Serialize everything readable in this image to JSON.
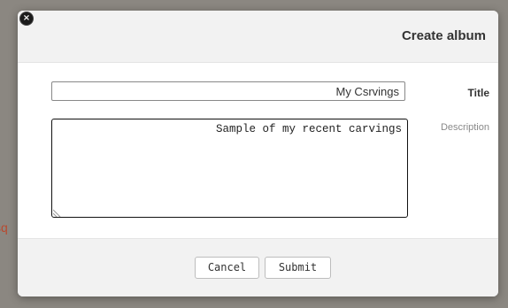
{
  "backdrop": {
    "partial_text": "sq"
  },
  "modal": {
    "title": "Create album",
    "close_glyph": "×",
    "fields": {
      "title_label": "Title",
      "title_value": "My Csrvings",
      "description_label": "Description",
      "description_value": "Sample of my recent carvings"
    },
    "footer": {
      "submit_label": "Submit",
      "cancel_label": "Cancel"
    }
  },
  "colors": {
    "backdrop": "#8b8781",
    "header_bg": "#f2f2f2",
    "footer_bg": "#f2f2f2",
    "panel_bg": "#ffffff",
    "title_text": "#333333",
    "close_button_bg": "#1b1b1b"
  },
  "icons": {
    "close": "close-icon",
    "resize": "resize-grip-icon"
  }
}
